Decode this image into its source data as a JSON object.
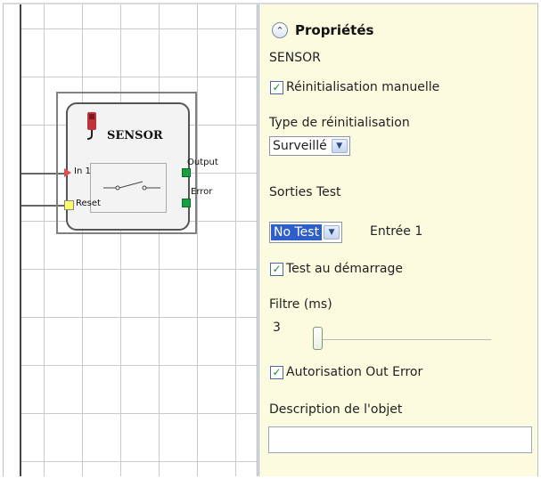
{
  "block": {
    "title": "SENSOR",
    "input1": "In 1",
    "reset": "Reset",
    "output": "Output",
    "error": "Error"
  },
  "properties": {
    "title": "Propriétés",
    "component": "SENSOR",
    "manual_reset": {
      "label": "Réinitialisation manuelle",
      "checked": true
    },
    "reset_type_label": "Type de réinitialisation",
    "reset_type_value": "Surveillé",
    "test_outputs_label": "Sorties Test",
    "test_output_value": "No Test",
    "test_output_input": "Entrée 1",
    "startup_test": {
      "label": "Test au démarrage",
      "checked": true
    },
    "filter_label": "Filtre (ms)",
    "filter_value": "3",
    "out_error": {
      "label": "Autorisation Out Error",
      "checked": true
    },
    "description_label": "Description de l'objet",
    "description_value": ""
  },
  "icons": {
    "collapse": "chevron-up-icon",
    "sensor": "photoelectric-sensor-icon",
    "check": "check-icon",
    "dropdown": "chevron-down-icon"
  },
  "colors": {
    "panel_bg": "#fcfbe0",
    "highlight": "#2d5ec9",
    "port_output": "#18a040",
    "port_input": "#e05050",
    "port_reset": "#ffff66"
  }
}
